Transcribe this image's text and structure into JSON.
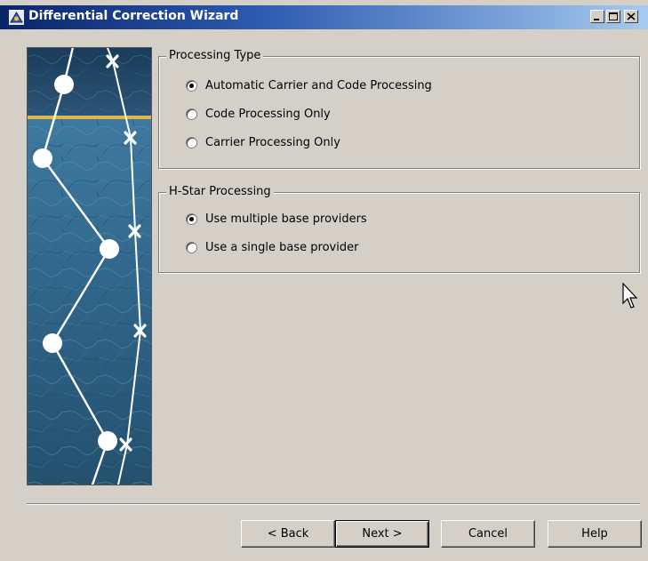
{
  "window": {
    "title": "Differential Correction Wizard",
    "titlebar_buttons": [
      "minimize-icon",
      "maximize-icon",
      "close-icon"
    ],
    "colors": {
      "titlebar_start": "#0a246a",
      "titlebar_end": "#a6caf0",
      "face": "#d4d0c8"
    }
  },
  "processing_type": {
    "legend": "Processing Type",
    "options": [
      {
        "label": "Automatic Carrier and Code Processing",
        "checked": true
      },
      {
        "label": "Code Processing Only",
        "checked": false
      },
      {
        "label": "Carrier Processing Only",
        "checked": false
      }
    ]
  },
  "hstar": {
    "legend": "H-Star Processing",
    "options": [
      {
        "label": "Use multiple base providers",
        "checked": true
      },
      {
        "label": "Use a single base provider",
        "checked": false
      }
    ]
  },
  "buttons": {
    "back": "< Back",
    "next": "Next >",
    "cancel": "Cancel",
    "help": "Help"
  }
}
